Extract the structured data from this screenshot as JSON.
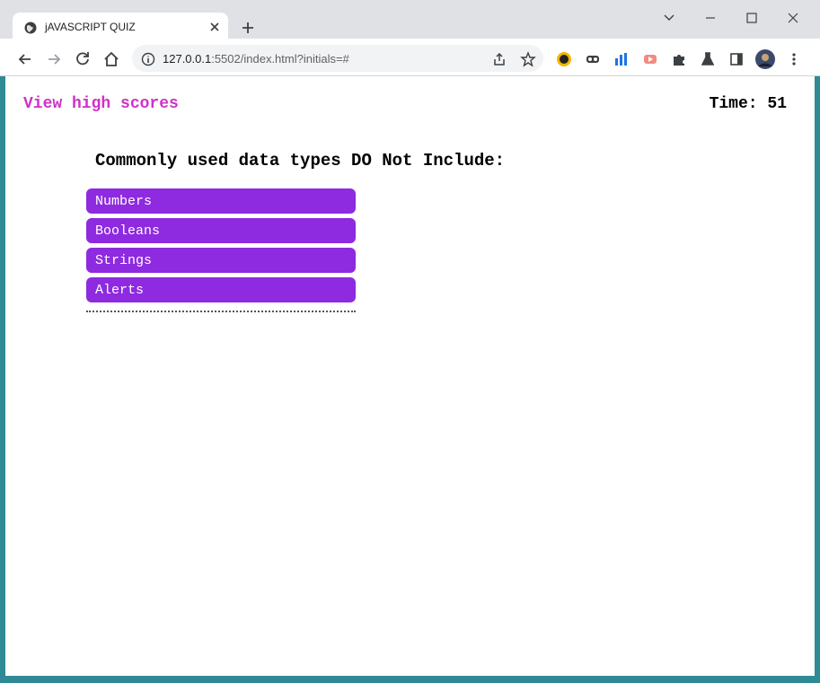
{
  "browser": {
    "tab": {
      "title": "jAVASCRIPT QUIZ"
    },
    "address": {
      "host": "127.0.0.1",
      "path": ":5502/index.html?initials=#"
    }
  },
  "page": {
    "high_scores_link": "View high scores",
    "timer_label": "Time:",
    "timer_value": "51",
    "question": "Commonly used data types DO Not Include:",
    "choices": [
      "Numbers",
      "Booleans",
      "Strings",
      "Alerts"
    ]
  },
  "colors": {
    "link": "#d030c8",
    "choice_bg": "#8e2ae0",
    "choice_text": "#ffffff"
  },
  "icons": [
    "globe-icon",
    "close-icon",
    "plus-icon",
    "chevron-down-icon",
    "minimize-icon",
    "maximize-icon",
    "window-close-icon",
    "back-icon",
    "forward-icon",
    "reload-icon",
    "home-icon",
    "info-icon",
    "share-icon",
    "star-icon",
    "extension-icon",
    "puzzle-icon",
    "sidepanel-icon",
    "profile-avatar",
    "menu-icon"
  ]
}
